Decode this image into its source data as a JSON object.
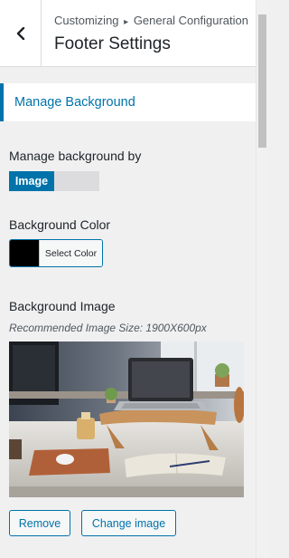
{
  "header": {
    "breadcrumb_parent": "Customizing",
    "breadcrumb_separator": "▸",
    "breadcrumb_current": "General Configuration",
    "title": "Footer Settings",
    "back_icon": "chevron-left-icon"
  },
  "section": {
    "title": "Manage Background",
    "accent_color": "#0073aa"
  },
  "manage_by": {
    "label": "Manage background by",
    "selected_option": "Image"
  },
  "background_color": {
    "label": "Background Color",
    "swatch_color": "#000000",
    "button_label": "Select Color"
  },
  "background_image": {
    "label": "Background Image",
    "hint": "Recommended Image Size: 1900X600px",
    "remove_label": "Remove",
    "change_label": "Change image"
  }
}
